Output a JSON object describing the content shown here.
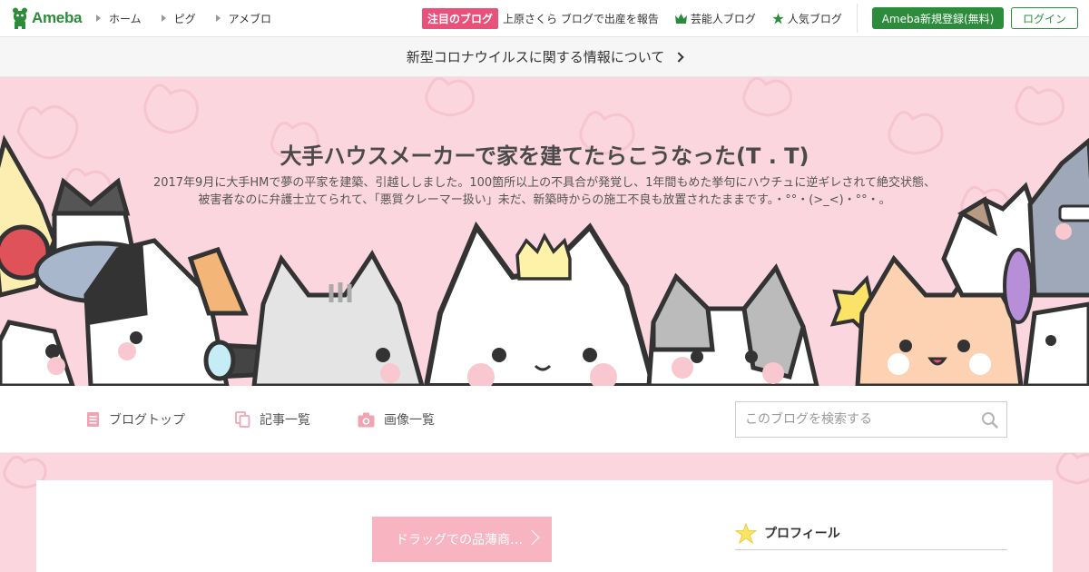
{
  "topbar": {
    "logo_text": "Ameba",
    "nav": [
      {
        "label": "ホーム"
      },
      {
        "label": "ピグ"
      },
      {
        "label": "アメブロ"
      }
    ],
    "focus_badge": "注目のブログ",
    "focus_link": "上原さくら ブログで出産を報告",
    "celebrity_link": "芸能人ブログ",
    "popular_link": "人気ブログ",
    "register_label": "Ameba新規登録(無料)",
    "login_label": "ログイン",
    "colors": {
      "brand": "#2d8c3c",
      "focus": "#e8527a"
    }
  },
  "notice": {
    "text": "新型コロナウイルスに関する情報について"
  },
  "header": {
    "title": "大手ハウスメーカーで家を建てたらこうなった(T . T)",
    "description": "2017年9月に大手HMで夢の平家を建築、引越ししました。100箇所以上の不具合が発覚し、1年間もめた挙句にハウチュに逆ギレされて絶交状態、被害者なのに弁護士立てられて、「悪質クレーマー扱い」未だ、新築時からの施工不良も放置されたままです。・°°・(>_<)・°°・。",
    "bg_color": "#fbd6de"
  },
  "blognav": {
    "items": [
      {
        "label": "ブログトップ",
        "icon": "document-icon"
      },
      {
        "label": "記事一覧",
        "icon": "copy-icon"
      },
      {
        "label": "画像一覧",
        "icon": "camera-icon"
      }
    ],
    "search_placeholder": "このブログを検索する"
  },
  "content": {
    "pager_label": "ドラッグでの品薄商…",
    "sidebar_title": "プロフィール"
  }
}
